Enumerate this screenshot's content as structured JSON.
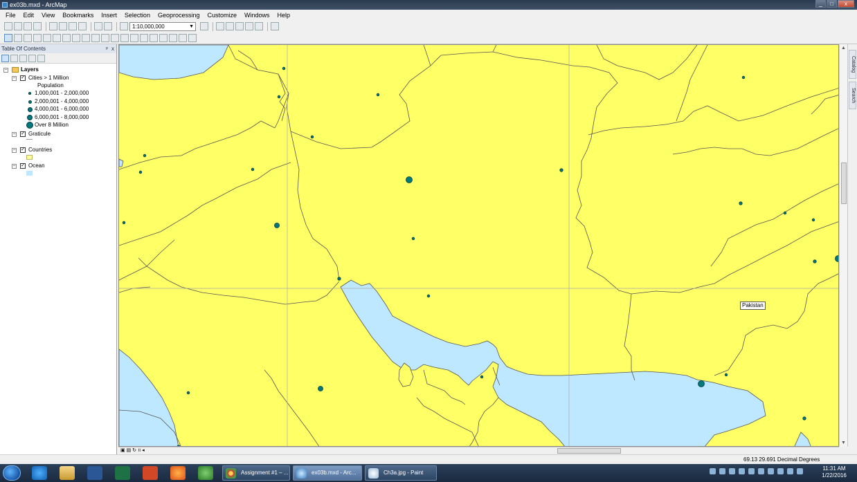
{
  "window": {
    "title": "ex03b.mxd - ArcMap",
    "controls": [
      "_",
      "□",
      "x"
    ]
  },
  "menu": [
    "File",
    "Edit",
    "View",
    "Bookmarks",
    "Insert",
    "Selection",
    "Geoprocessing",
    "Customize",
    "Windows",
    "Help"
  ],
  "toolbar": {
    "scale": "1:10,000,000"
  },
  "toc": {
    "title": "Table Of Contents",
    "pin": "ᵖ",
    "close": "x",
    "layers_label": "Layers",
    "cities": {
      "label": "Cities > 1 Million",
      "field": "Population",
      "classes": [
        "1,000,001 - 2,000,000",
        "2,000,001 - 4,000,000",
        "4,000,001 - 6,000,000",
        "6,000,001 - 8,000,000",
        "Over 8 Million"
      ]
    },
    "graticule": "Graticule",
    "countries": "Countries",
    "ocean": "Ocean"
  },
  "map": {
    "label": "Pakistan",
    "colors": {
      "land": "#ffff66",
      "water": "#bee8ff",
      "border": "#555555",
      "city": "#00797e"
    }
  },
  "side_tabs": [
    "Catalog",
    "Search"
  ],
  "status": {
    "coords": "69.13  29.691 Decimal Degrees"
  },
  "taskbar": {
    "tasks": [
      "Assignment #1 – ...",
      "ex03b.mxd - Arc...",
      "Ch3a.jpg - Paint"
    ],
    "time": "11:31 AM",
    "date": "1/22/2016"
  }
}
